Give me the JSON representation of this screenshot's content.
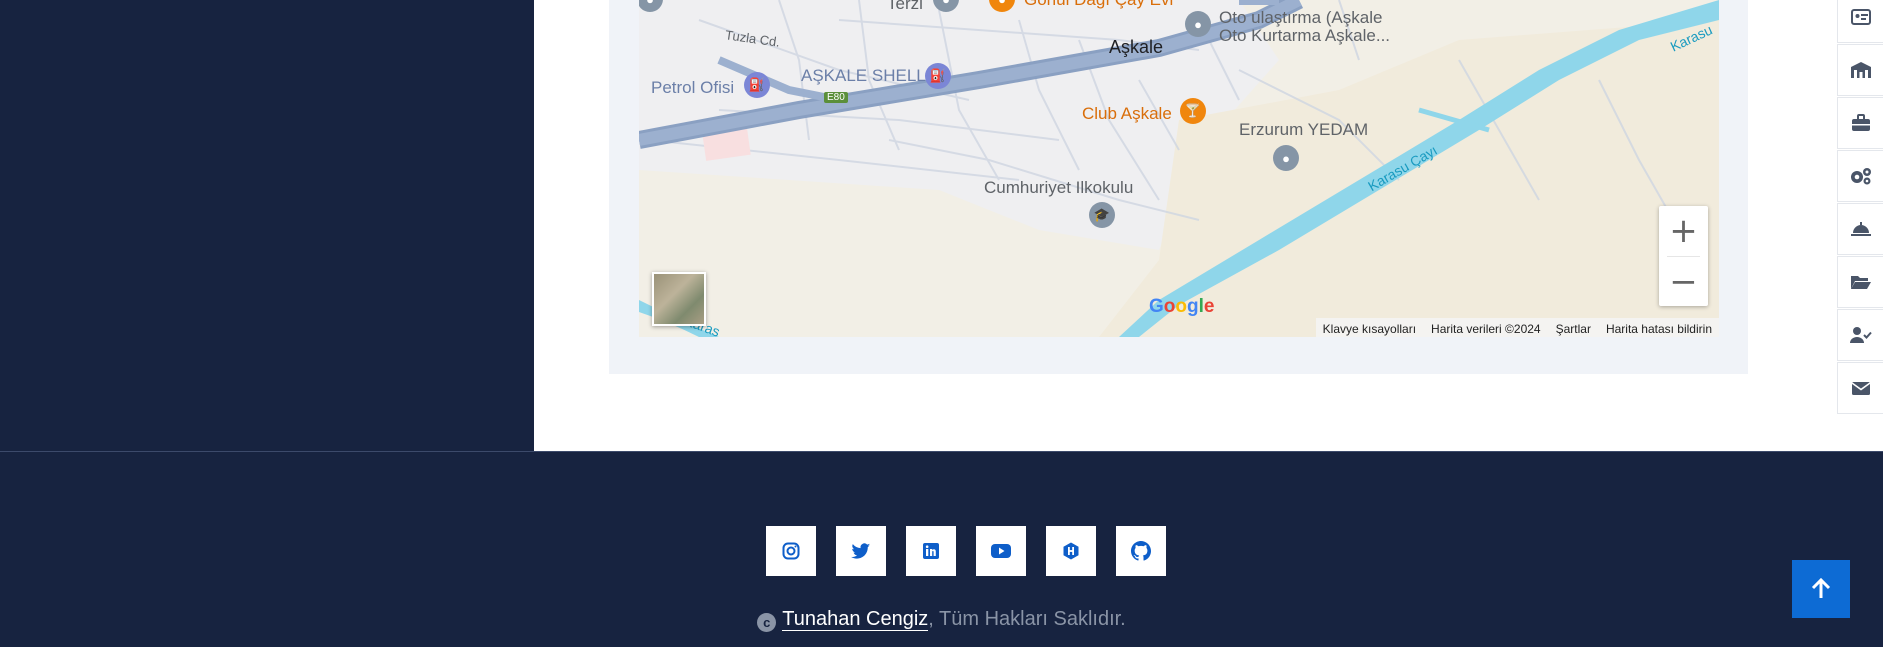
{
  "map": {
    "labels": {
      "terzi": "Terzi",
      "cafe": "Gönül Dağı Çay Evi",
      "oto": "Oto ulaştırma (Aşkale",
      "oto2": "Oto Kurtarma Aşkale...",
      "askale": "Aşkale",
      "tuzla": "Tuzla Cd.",
      "petrol": "Petrol Ofisi",
      "shell": "AŞKALE SHELL",
      "e80": "E80",
      "club": "Club Aşkale",
      "yedam": "Erzurum YEDAM",
      "karasu": "Karasu Çayı",
      "karasu2": "Karasu",
      "karasu3": "Karas",
      "school": "Cumhuriyet Ilkokulu"
    },
    "zoom_in": "+",
    "zoom_out": "−",
    "google_logo": "Google",
    "attribution": {
      "shortcuts": "Klavye kısayolları",
      "data": "Harita verileri ©2024",
      "terms": "Şartlar",
      "report": "Harita hatası bildirin"
    }
  },
  "right_rail": [
    {
      "icon": "id-card-icon"
    },
    {
      "icon": "school-icon"
    },
    {
      "icon": "briefcase-icon"
    },
    {
      "icon": "gears-icon"
    },
    {
      "icon": "bell-concierge-icon"
    },
    {
      "icon": "folder-open-icon"
    },
    {
      "icon": "user-check-icon"
    },
    {
      "icon": "envelope-icon"
    }
  ],
  "footer": {
    "social": [
      {
        "icon": "instagram-icon"
      },
      {
        "icon": "twitter-icon"
      },
      {
        "icon": "linkedin-icon"
      },
      {
        "icon": "youtube-icon"
      },
      {
        "icon": "hashnode-icon"
      },
      {
        "icon": "github-icon"
      }
    ],
    "copyright_symbol": "c",
    "author": "Tunahan Cengiz",
    "rights": ", Tüm Hakları Saklıdır."
  },
  "colors": {
    "navy": "#172340",
    "accent": "#0d6bd4",
    "map_road": "#8aa0c2",
    "river": "#8fd6ea"
  }
}
